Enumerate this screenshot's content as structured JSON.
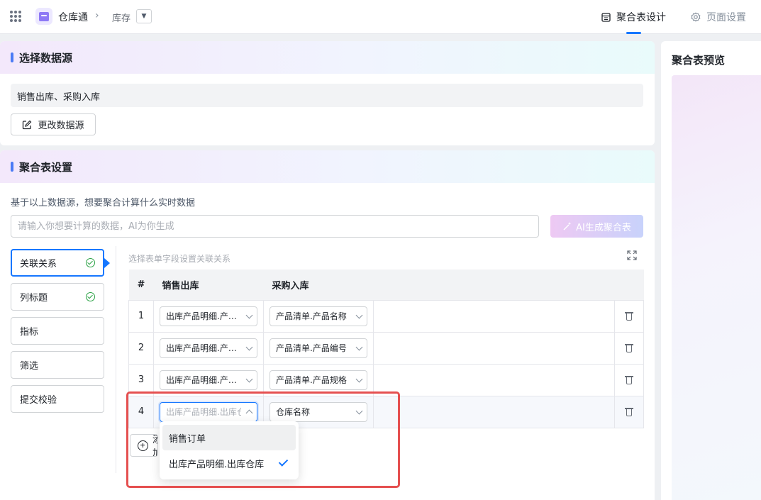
{
  "header": {
    "app_name": "仓库通",
    "breadcrumb": "库存",
    "tabs": [
      {
        "label": "聚合表设计",
        "active": true
      },
      {
        "label": "页面设置",
        "active": false
      }
    ]
  },
  "datasource": {
    "title": "选择数据源",
    "value": "销售出库、采购入库",
    "change_button": "更改数据源"
  },
  "agg_settings": {
    "title": "聚合表设置",
    "question": "基于以上数据源，想要聚合计算什么实时数据",
    "input_placeholder": "请输入你想要计算的数据，AI为你生成",
    "ai_button": "AI生成聚合表",
    "steps": [
      {
        "label": "关联关系",
        "active": true,
        "done": true
      },
      {
        "label": "列标题",
        "active": false,
        "done": true
      },
      {
        "label": "指标",
        "active": false,
        "done": false
      },
      {
        "label": "筛选",
        "active": false,
        "done": false
      },
      {
        "label": "提交校验",
        "active": false,
        "done": false
      }
    ],
    "relation_hint": "选择表单字段设置关联关系",
    "table": {
      "headers": [
        "#",
        "销售出库",
        "采购入库"
      ],
      "rows": [
        {
          "num": "1",
          "left": "出库产品明细.产品名称",
          "right": "产品清单.产品名称"
        },
        {
          "num": "2",
          "left": "出库产品明细.产品编号",
          "right": "产品清单.产品编号"
        },
        {
          "num": "3",
          "left": "出库产品明细.产品规格",
          "right": "产品清单.产品规格"
        },
        {
          "num": "4",
          "left_placeholder": "出库产品明细.出库仓库",
          "right": "仓库名称"
        }
      ]
    },
    "add_button": "添加",
    "dropdown": {
      "options": [
        {
          "label": "销售订单",
          "selected": false
        },
        {
          "label": "出库产品明细.出库仓库",
          "selected": true
        }
      ]
    }
  },
  "preview": {
    "title": "聚合表预览"
  }
}
